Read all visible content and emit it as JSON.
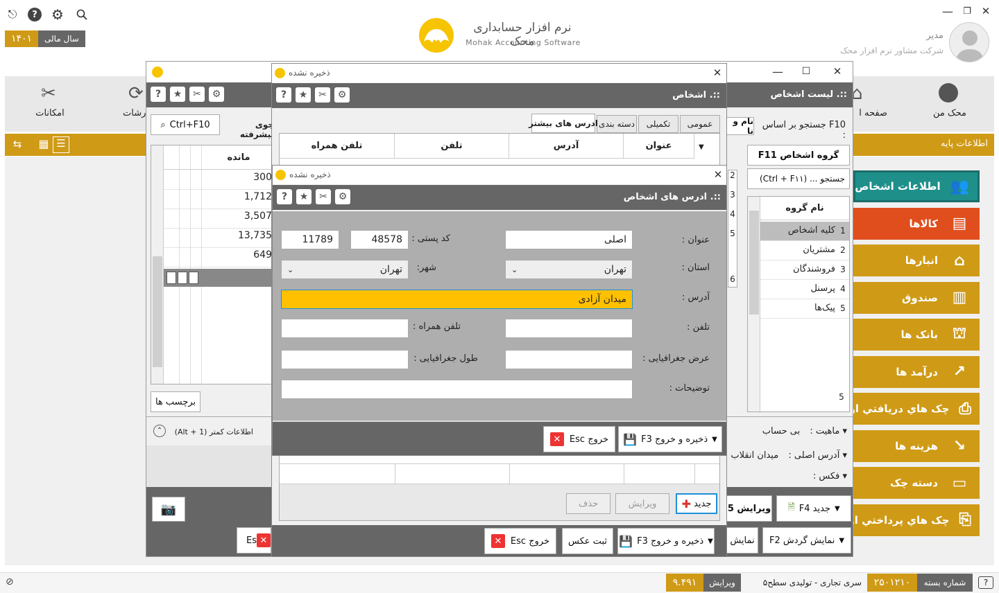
{
  "app": {
    "brand_fa": "نرم افزار حسابداری محک",
    "brand_en": "Mohak Accounting Software",
    "fiscal_label": "سال مالی",
    "fiscal_year": "۱۴۰۱",
    "user_role": "مدیر",
    "user_company": "شرکت مشاور نرم افزار محک"
  },
  "topnav": {
    "tools": "امکانات",
    "reports": "ارشات",
    "home": "صفحه ا",
    "mohak": "محک من"
  },
  "base_info": "اطلاعات پایه",
  "sidebar": {
    "items": [
      {
        "label": "اطلاعات اشخاص",
        "icon": "people-icon"
      },
      {
        "label": "کالاها",
        "icon": "goods-icon"
      },
      {
        "label": "انبارها",
        "icon": "warehouse-icon"
      },
      {
        "label": "صندوق",
        "icon": "cash-register-icon"
      },
      {
        "label": "بانک ها",
        "icon": "bank-icon"
      },
      {
        "label": "درآمد ها",
        "icon": "income-icon"
      },
      {
        "label": "چک هاي دريافتي اول",
        "icon": "cheque-in-icon"
      },
      {
        "label": "هزینه ها",
        "icon": "expense-icon"
      },
      {
        "label": "دسته چک",
        "icon": "chequebook-icon"
      },
      {
        "label": "چک هاي پرداختي اول",
        "icon": "cheque-out-icon"
      }
    ]
  },
  "list_window": {
    "title": "::. لیست اشخاص",
    "search_label": "F10 جستجو بر اساس :",
    "search_field": "نام و نا",
    "search_button": "Ctrl+F10",
    "advanced": "جوی پیشرفته",
    "group_button": "گروه اشخاص F11",
    "group_search": "جستجو ... (Ctrl + F۱۱)",
    "group_col": "نام گروه",
    "groups": [
      {
        "n": "1",
        "name": "کلیه اشخاص"
      },
      {
        "n": "2",
        "name": "مشتریان"
      },
      {
        "n": "3",
        "name": "فروشندگان"
      },
      {
        "n": "4",
        "name": "پرسنل"
      },
      {
        "n": "5",
        "name": "پیک‌ها"
      }
    ],
    "group_footer": "5",
    "balance_col": "مانده",
    "balances": [
      "300",
      "1,712",
      "3,507",
      "13,735",
      "649"
    ],
    "row_nums": [
      "2",
      "3",
      "4",
      "5",
      "6"
    ],
    "tags_button": "برچسب ها",
    "less_info": "اطلاعات کمتر (Alt + 1)",
    "nature_label": "ماهیت :",
    "nature_value": "بی حساب",
    "main_address_label": "آدرس اصلی :",
    "main_address_value": "میدان انقلاب",
    "fax_label": "فکس :",
    "new_button": "جدید F4",
    "edit_button": "ویرایش 5",
    "turnover_button": "نمایش گردش F2",
    "show_button": "نمایش",
    "esc_partial": "Es"
  },
  "person_window": {
    "title": "ذخیره نشده",
    "header": "::. اشخاص",
    "tabs": [
      "عمومی",
      "تکمیلی",
      "دسته بندی",
      "ادرس های بیشتر"
    ],
    "cols": [
      "عنوان",
      "آدرس",
      "تلفن",
      "تلفن همراه"
    ],
    "new": "جدید",
    "edit": "ویرایش",
    "delete": "حذف",
    "save_exit": "ذخیره و خروج F3",
    "photo": "ثبت عکس",
    "exit": "خروج Esc"
  },
  "address_window": {
    "title": "ذخیره نشده",
    "header": "::. ادرس های اشخاص",
    "title_label": "عنوان :",
    "title_value": "اصلی",
    "postal_label": "کد پستی :",
    "postal_1": "48578",
    "postal_2": "11789",
    "province_label": "استان :",
    "province_value": "تهران",
    "city_label": "شهر:",
    "city_value": "تهران",
    "address_label": "آدرس :",
    "address_value": "میدان آزادی",
    "phone_label": "تلفن :",
    "mobile_label": "تلفن همراه :",
    "lat_label": "عرض جغرافیایی :",
    "lon_label": "طول جغرافیایی :",
    "notes_label": "توضیحات :",
    "save_exit": "ذخیره و خروج F3",
    "exit": "خروج Esc"
  },
  "statusbar": {
    "package_label": "شماره بسته",
    "package_value": "۲۵۰۱۲۱۰",
    "series": "سری تجاری - تولیدی سطح۵",
    "version_label": "ویرایش",
    "version_value": "۹.۴۹۱"
  },
  "colors": {
    "gold": "#cf9a16",
    "dark": "#666666",
    "highlight": "#ffc000",
    "teal": "#1f8f8a",
    "red": "#e04e1e"
  }
}
